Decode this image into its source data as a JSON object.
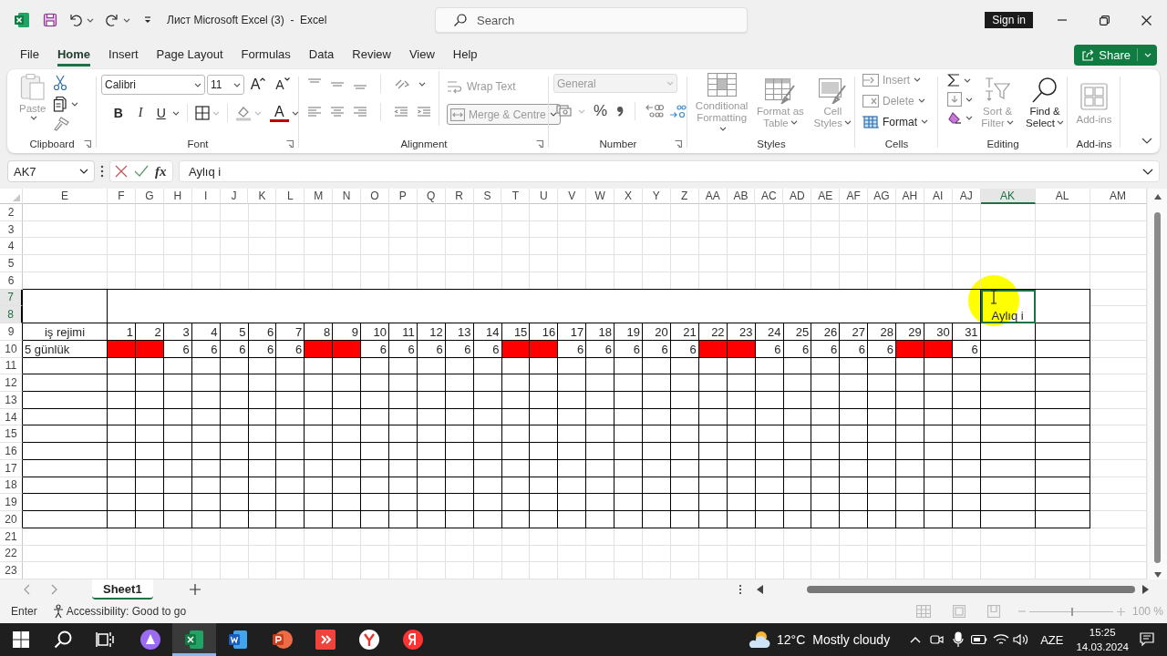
{
  "titlebar": {
    "title": "Лист Microsoft Excel (3)  -  Excel",
    "search": {
      "placeholder": "Search"
    },
    "sign_in": "Sign in"
  },
  "menu": {
    "tabs": [
      {
        "label": "File",
        "selected": false
      },
      {
        "label": "Home",
        "selected": true
      },
      {
        "label": "Insert",
        "selected": false
      },
      {
        "label": "Page Layout",
        "selected": false
      },
      {
        "label": "Formulas",
        "selected": false
      },
      {
        "label": "Data",
        "selected": false
      },
      {
        "label": "Review",
        "selected": false
      },
      {
        "label": "View",
        "selected": false
      },
      {
        "label": "Help",
        "selected": false
      }
    ],
    "share": "Share"
  },
  "ribbon": [
    {
      "kind": "clipboard",
      "label": "Clipboard",
      "paste": {
        "label": "Paste",
        "disabled": true
      }
    },
    {
      "kind": "font",
      "label": "Font",
      "font_name": "Calibri",
      "font_size": "11",
      "grow": "A",
      "shrink": "A",
      "bold": "B",
      "italic": "I",
      "underline": "U",
      "font_color": "A"
    },
    {
      "kind": "alignment",
      "label": "Alignment",
      "wrap_text": {
        "label": "Wrap Text",
        "disabled": true
      },
      "merge": {
        "label": "Merge & Centre",
        "disabled": true
      }
    },
    {
      "kind": "number",
      "label": "Number",
      "format": {
        "value": "General",
        "disabled": true
      },
      "percent": "%"
    },
    {
      "kind": "styles",
      "label": "Styles",
      "buttons": [
        {
          "label": "Conditional Formatting",
          "disabled": true
        },
        {
          "label": "Format as Table",
          "disabled": true
        },
        {
          "label": "Cell Styles",
          "disabled": true
        }
      ]
    },
    {
      "kind": "cells",
      "label": "Cells",
      "buttons": [
        {
          "label": "Insert",
          "disabled": true
        },
        {
          "label": "Delete",
          "disabled": true
        },
        {
          "label": "Format",
          "disabled": false
        }
      ]
    },
    {
      "kind": "editing",
      "label": "Editing",
      "buttons": [
        {
          "label": "Sort & Filter",
          "disabled": true
        },
        {
          "label": "Find & Select",
          "disabled": false
        }
      ]
    },
    {
      "kind": "addins",
      "label": "Add-ins",
      "button": {
        "label": "Add-ins",
        "disabled": true
      }
    }
  ],
  "formula_bar": {
    "name_box": "AK7",
    "function_button": "fx",
    "formula": "Aylıq i"
  },
  "sheet": {
    "columns": [
      {
        "label": "E",
        "selected": false
      },
      {
        "label": "F",
        "selected": false
      },
      {
        "label": "G",
        "selected": false
      },
      {
        "label": "H",
        "selected": false
      },
      {
        "label": "I",
        "selected": false
      },
      {
        "label": "J",
        "selected": false
      },
      {
        "label": "K",
        "selected": false
      },
      {
        "label": "L",
        "selected": false
      },
      {
        "label": "M",
        "selected": false
      },
      {
        "label": "N",
        "selected": false
      },
      {
        "label": "O",
        "selected": false
      },
      {
        "label": "P",
        "selected": false
      },
      {
        "label": "Q",
        "selected": false
      },
      {
        "label": "R",
        "selected": false
      },
      {
        "label": "S",
        "selected": false
      },
      {
        "label": "T",
        "selected": false
      },
      {
        "label": "U",
        "selected": false
      },
      {
        "label": "V",
        "selected": false
      },
      {
        "label": "W",
        "selected": false
      },
      {
        "label": "X",
        "selected": false
      },
      {
        "label": "Y",
        "selected": false
      },
      {
        "label": "Z",
        "selected": false
      },
      {
        "label": "AA",
        "selected": false
      },
      {
        "label": "AB",
        "selected": false
      },
      {
        "label": "AC",
        "selected": false
      },
      {
        "label": "AD",
        "selected": false
      },
      {
        "label": "AE",
        "selected": false
      },
      {
        "label": "AF",
        "selected": false
      },
      {
        "label": "AG",
        "selected": false
      },
      {
        "label": "AH",
        "selected": false
      },
      {
        "label": "AI",
        "selected": false
      },
      {
        "label": "AJ",
        "selected": false
      },
      {
        "label": "AK",
        "selected": true
      },
      {
        "label": "AL",
        "selected": false
      },
      {
        "label": "AM",
        "selected": false
      }
    ],
    "rows": [
      {
        "label": "2",
        "selected": false
      },
      {
        "label": "3",
        "selected": false
      },
      {
        "label": "4",
        "selected": false
      },
      {
        "label": "5",
        "selected": false
      },
      {
        "label": "6",
        "selected": false
      },
      {
        "label": "7",
        "selected": true
      },
      {
        "label": "8",
        "selected": true
      },
      {
        "label": "9",
        "selected": false
      },
      {
        "label": "10",
        "selected": false
      },
      {
        "label": "11",
        "selected": false
      },
      {
        "label": "12",
        "selected": false
      },
      {
        "label": "13",
        "selected": false
      },
      {
        "label": "14",
        "selected": false
      },
      {
        "label": "15",
        "selected": false
      },
      {
        "label": "16",
        "selected": false
      },
      {
        "label": "17",
        "selected": false
      },
      {
        "label": "18",
        "selected": false
      },
      {
        "label": "19",
        "selected": false
      },
      {
        "label": "20",
        "selected": false
      },
      {
        "label": "21",
        "selected": false
      },
      {
        "label": "22",
        "selected": false
      },
      {
        "label": "23",
        "selected": false
      }
    ],
    "active_cell": "Aylıq i",
    "day_row": {
      "label": "iş rejimi",
      "days": [
        "1",
        "2",
        "3",
        "4",
        "5",
        "6",
        "7",
        "8",
        "9",
        "10",
        "11",
        "12",
        "13",
        "14",
        "15",
        "16",
        "17",
        "18",
        "19",
        "20",
        "21",
        "22",
        "23",
        "24",
        "25",
        "26",
        "27",
        "28",
        "29",
        "30",
        "31"
      ]
    },
    "regime_row": {
      "label": "5 günlük",
      "cells": [
        {
          "filled": true
        },
        {
          "filled": true
        },
        {
          "value": "6",
          "filled": false
        },
        {
          "value": "6",
          "filled": false
        },
        {
          "value": "6",
          "filled": false
        },
        {
          "value": "6",
          "filled": false
        },
        {
          "value": "6",
          "filled": false
        },
        {
          "filled": true
        },
        {
          "filled": true
        },
        {
          "value": "6",
          "filled": false
        },
        {
          "value": "6",
          "filled": false
        },
        {
          "value": "6",
          "filled": false
        },
        {
          "value": "6",
          "filled": false
        },
        {
          "value": "6",
          "filled": false
        },
        {
          "filled": true
        },
        {
          "filled": true
        },
        {
          "value": "6",
          "filled": false
        },
        {
          "value": "6",
          "filled": false
        },
        {
          "value": "6",
          "filled": false
        },
        {
          "value": "6",
          "filled": false
        },
        {
          "value": "6",
          "filled": false
        },
        {
          "filled": true
        },
        {
          "filled": true
        },
        {
          "value": "6",
          "filled": false
        },
        {
          "value": "6",
          "filled": false
        },
        {
          "value": "6",
          "filled": false
        },
        {
          "value": "6",
          "filled": false
        },
        {
          "value": "6",
          "filled": false
        },
        {
          "filled": true
        },
        {
          "filled": true
        },
        {
          "value": "6",
          "filled": false
        }
      ]
    }
  },
  "sheet_tabs": {
    "sheets": [
      {
        "label": "Sheet1",
        "selected": true
      }
    ]
  },
  "status_bar": {
    "mode": "Enter",
    "accessibility": "Accessibility: Good to go",
    "zoom": {
      "level": 0.5,
      "reading": "100 %"
    }
  },
  "taskbar": {
    "apps": [
      {
        "kind": "assistant",
        "selected": false
      },
      {
        "kind": "spreadsheet",
        "selected": true
      },
      {
        "kind": "document",
        "selected": false
      },
      {
        "kind": "presentation",
        "selected": false
      },
      {
        "kind": "remote",
        "selected": false
      },
      {
        "kind": "browser",
        "selected": false
      },
      {
        "kind": "circle_app",
        "selected": false
      }
    ],
    "temperature": "12°C",
    "weather": "Mostly cloudy",
    "language": "AZE",
    "time": "15:25",
    "date": "14.03.2024"
  }
}
